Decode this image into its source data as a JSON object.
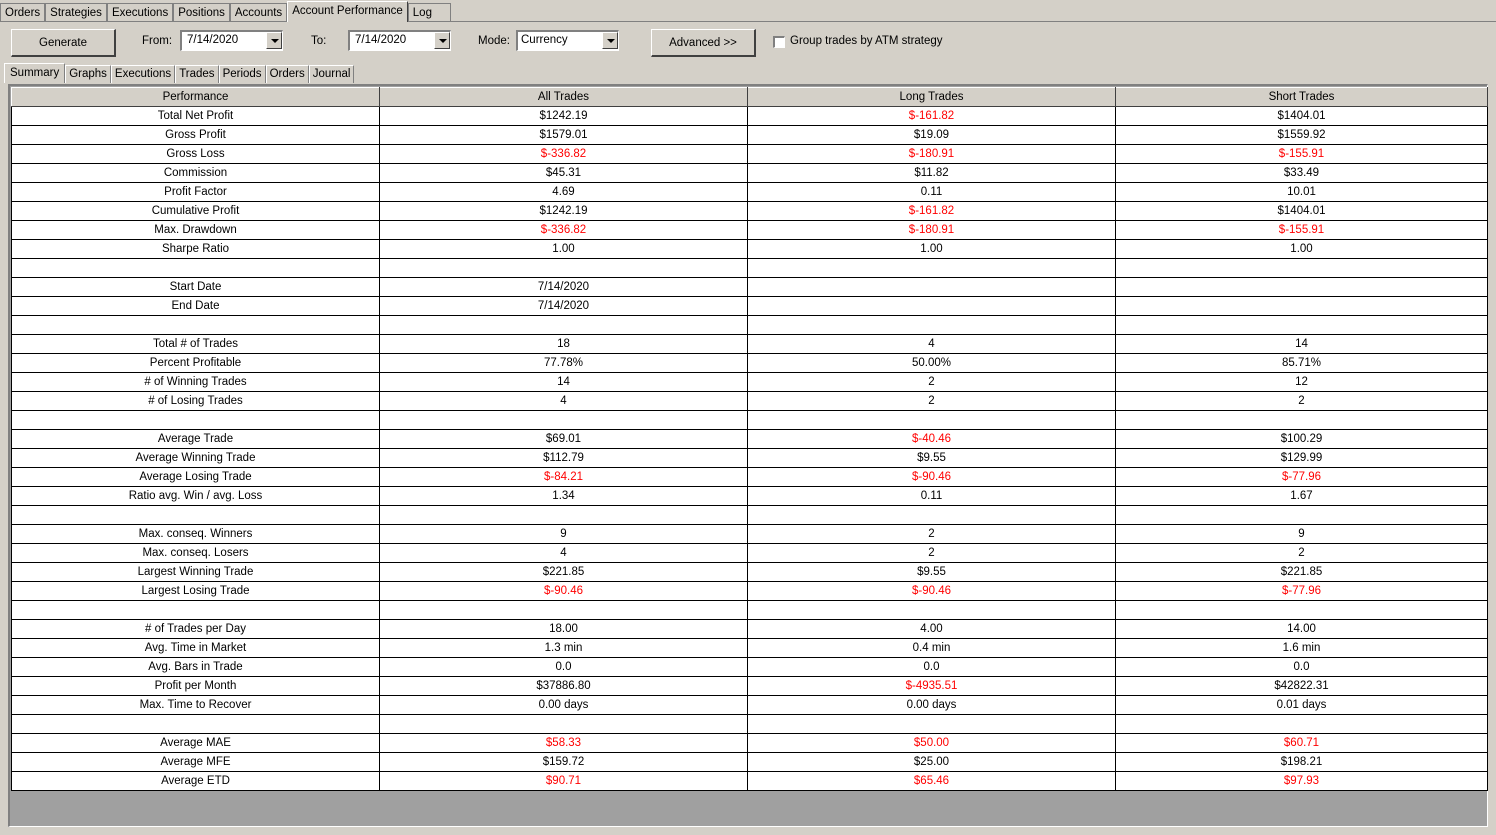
{
  "outer_tabs": [
    "Orders",
    "Strategies",
    "Executions",
    "Positions",
    "Accounts",
    "Account Performance",
    "Log"
  ],
  "outer_active": 5,
  "toolbar": {
    "generate_label": "Generate",
    "from_label": "From:",
    "from_value": "7/14/2020",
    "to_label": "To:",
    "to_value": "7/14/2020",
    "mode_label": "Mode:",
    "mode_value": "Currency",
    "advanced_label": "Advanced >>",
    "group_label": "Group trades by ATM strategy",
    "group_checked": false
  },
  "inner_tabs": [
    "Summary",
    "Graphs",
    "Executions",
    "Trades",
    "Periods",
    "Orders",
    "Journal"
  ],
  "inner_active": 0,
  "colors": {
    "negative": "#ff0000",
    "panel": "#d4d0c8"
  },
  "table": {
    "headers": [
      "Performance",
      "All Trades",
      "Long Trades",
      "Short Trades"
    ],
    "rows": [
      [
        "Total Net Profit",
        "$1242.19",
        "$-161.82",
        "$1404.01"
      ],
      [
        "Gross Profit",
        "$1579.01",
        "$19.09",
        "$1559.92"
      ],
      [
        "Gross Loss",
        "$-336.82",
        "$-180.91",
        "$-155.91"
      ],
      [
        "Commission",
        "$45.31",
        "$11.82",
        "$33.49"
      ],
      [
        "Profit Factor",
        "4.69",
        "0.11",
        "10.01"
      ],
      [
        "Cumulative Profit",
        "$1242.19",
        "$-161.82",
        "$1404.01"
      ],
      [
        "Max. Drawdown",
        "$-336.82",
        "$-180.91",
        "$-155.91"
      ],
      [
        "Sharpe Ratio",
        "1.00",
        "1.00",
        "1.00"
      ],
      [
        "",
        "",
        "",
        ""
      ],
      [
        "Start Date",
        "7/14/2020",
        "",
        ""
      ],
      [
        "End Date",
        "7/14/2020",
        "",
        ""
      ],
      [
        "",
        "",
        "",
        ""
      ],
      [
        "Total # of Trades",
        "18",
        "4",
        "14"
      ],
      [
        "Percent Profitable",
        "77.78%",
        "50.00%",
        "85.71%"
      ],
      [
        "# of Winning Trades",
        "14",
        "2",
        "12"
      ],
      [
        "# of Losing Trades",
        "4",
        "2",
        "2"
      ],
      [
        "",
        "",
        "",
        ""
      ],
      [
        "Average Trade",
        "$69.01",
        "$-40.46",
        "$100.29"
      ],
      [
        "Average Winning Trade",
        "$112.79",
        "$9.55",
        "$129.99"
      ],
      [
        "Average Losing Trade",
        "$-84.21",
        "$-90.46",
        "$-77.96"
      ],
      [
        "Ratio avg. Win / avg. Loss",
        "1.34",
        "0.11",
        "1.67"
      ],
      [
        "",
        "",
        "",
        ""
      ],
      [
        "Max. conseq. Winners",
        "9",
        "2",
        "9"
      ],
      [
        "Max. conseq. Losers",
        "4",
        "2",
        "2"
      ],
      [
        "Largest Winning Trade",
        "$221.85",
        "$9.55",
        "$221.85"
      ],
      [
        "Largest Losing Trade",
        "$-90.46",
        "$-90.46",
        "$-77.96"
      ],
      [
        "",
        "",
        "",
        ""
      ],
      [
        "# of Trades per Day",
        "18.00",
        "4.00",
        "14.00"
      ],
      [
        "Avg. Time in Market",
        "1.3 min",
        "0.4 min",
        "1.6 min"
      ],
      [
        "Avg. Bars in Trade",
        "0.0",
        "0.0",
        "0.0"
      ],
      [
        "Profit per Month",
        "$37886.80",
        "$-4935.51",
        "$42822.31"
      ],
      [
        "Max. Time to Recover",
        "0.00 days",
        "0.00 days",
        "0.01 days"
      ],
      [
        "",
        "",
        "",
        ""
      ],
      [
        "Average MAE",
        "$58.33",
        "$50.00",
        "$60.71"
      ],
      [
        "Average MFE",
        "$159.72",
        "$25.00",
        "$198.21"
      ],
      [
        "Average ETD",
        "$90.71",
        "$65.46",
        "$97.93"
      ]
    ],
    "red_rows": [
      33,
      35
    ]
  }
}
